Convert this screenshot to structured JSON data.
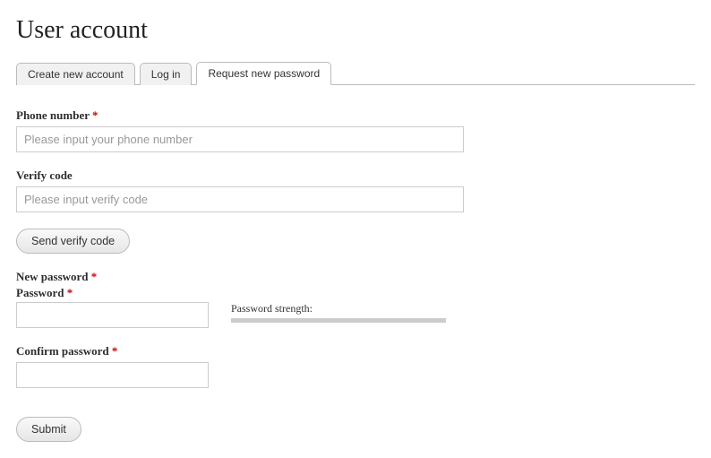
{
  "page": {
    "title": "User account"
  },
  "tabs": {
    "create": "Create new account",
    "login": "Log in",
    "request": "Request new password"
  },
  "labels": {
    "phone": "Phone number",
    "verify": "Verify code",
    "newpass": "New password",
    "password": "Password",
    "confirm": "Confirm password",
    "strength": "Password strength:"
  },
  "placeholders": {
    "phone": "Please input your phone number",
    "verify": "Please input verify code"
  },
  "buttons": {
    "sendcode": "Send verify code",
    "submit": "Submit"
  },
  "required_marker": "*"
}
